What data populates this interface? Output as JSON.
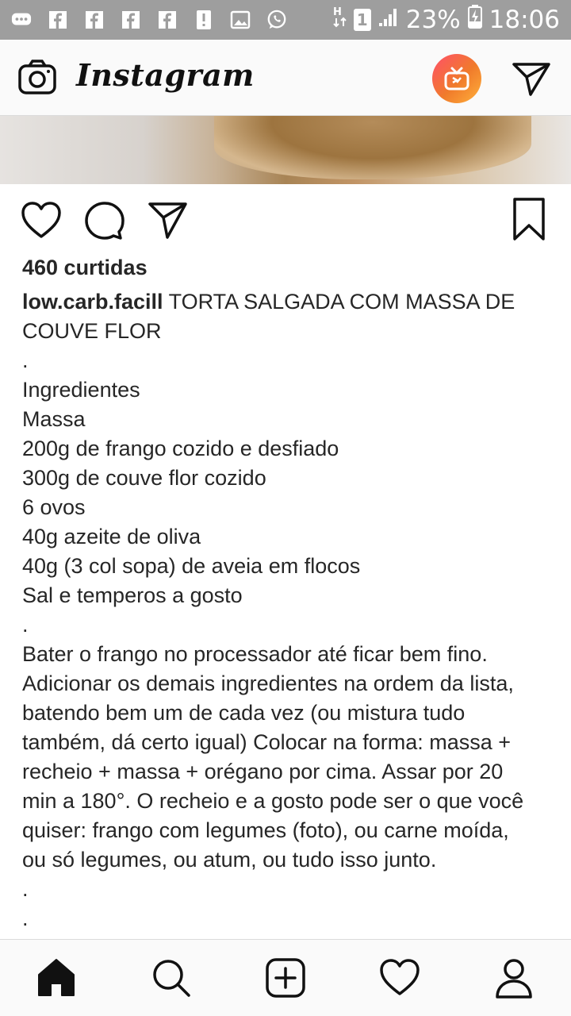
{
  "status_bar": {
    "battery": "23%",
    "time": "18:06",
    "sim": "1"
  },
  "header": {
    "logo": "Instagram"
  },
  "post": {
    "likes": "460 curtidas",
    "username": "low.carb.facill",
    "caption_lines": [
      "TORTA SALGADA COM MASSA DE",
      "COUVE FLOR",
      ".",
      "Ingredientes",
      "Massa",
      "200g de frango cozido e desfiado",
      "300g de couve flor cozido",
      "6 ovos",
      "40g azeite de oliva",
      "40g (3 col sopa) de aveia em flocos",
      "Sal e temperos a gosto",
      ".",
      "Bater o frango no processador até ficar bem fino.",
      "Adicionar os demais ingredientes na ordem da lista,",
      "batendo bem um de cada vez (ou mistura tudo",
      "também, dá certo igual) Colocar na forma: massa +",
      "recheio + massa + orégano por cima. Assar por 20",
      "min a 180°. O recheio e a gosto pode ser o que você",
      "quiser: frango com legumes (foto), ou carne moída,",
      "ou só legumes, ou atum, ou tudo isso junto.",
      ".",
      "."
    ]
  },
  "icons": {
    "status": [
      "message-icon",
      "facebook-icon",
      "facebook-icon",
      "facebook-icon",
      "facebook-icon",
      "alert-icon",
      "image-icon",
      "whatsapp-icon",
      "signal-icon",
      "battery-icon"
    ],
    "header": [
      "camera-icon",
      "igtv-icon",
      "direct-message-icon"
    ],
    "actions": [
      "heart-icon",
      "comment-icon",
      "share-icon",
      "bookmark-icon"
    ],
    "nav": [
      "home-icon",
      "search-icon",
      "add-icon",
      "heart-icon",
      "profile-icon"
    ]
  },
  "colors": {
    "status_bar": "#9e9e9e",
    "igtv_gradient_start": "#ff4f6a",
    "igtv_gradient_end": "#ffb13b",
    "text": "#262626"
  }
}
